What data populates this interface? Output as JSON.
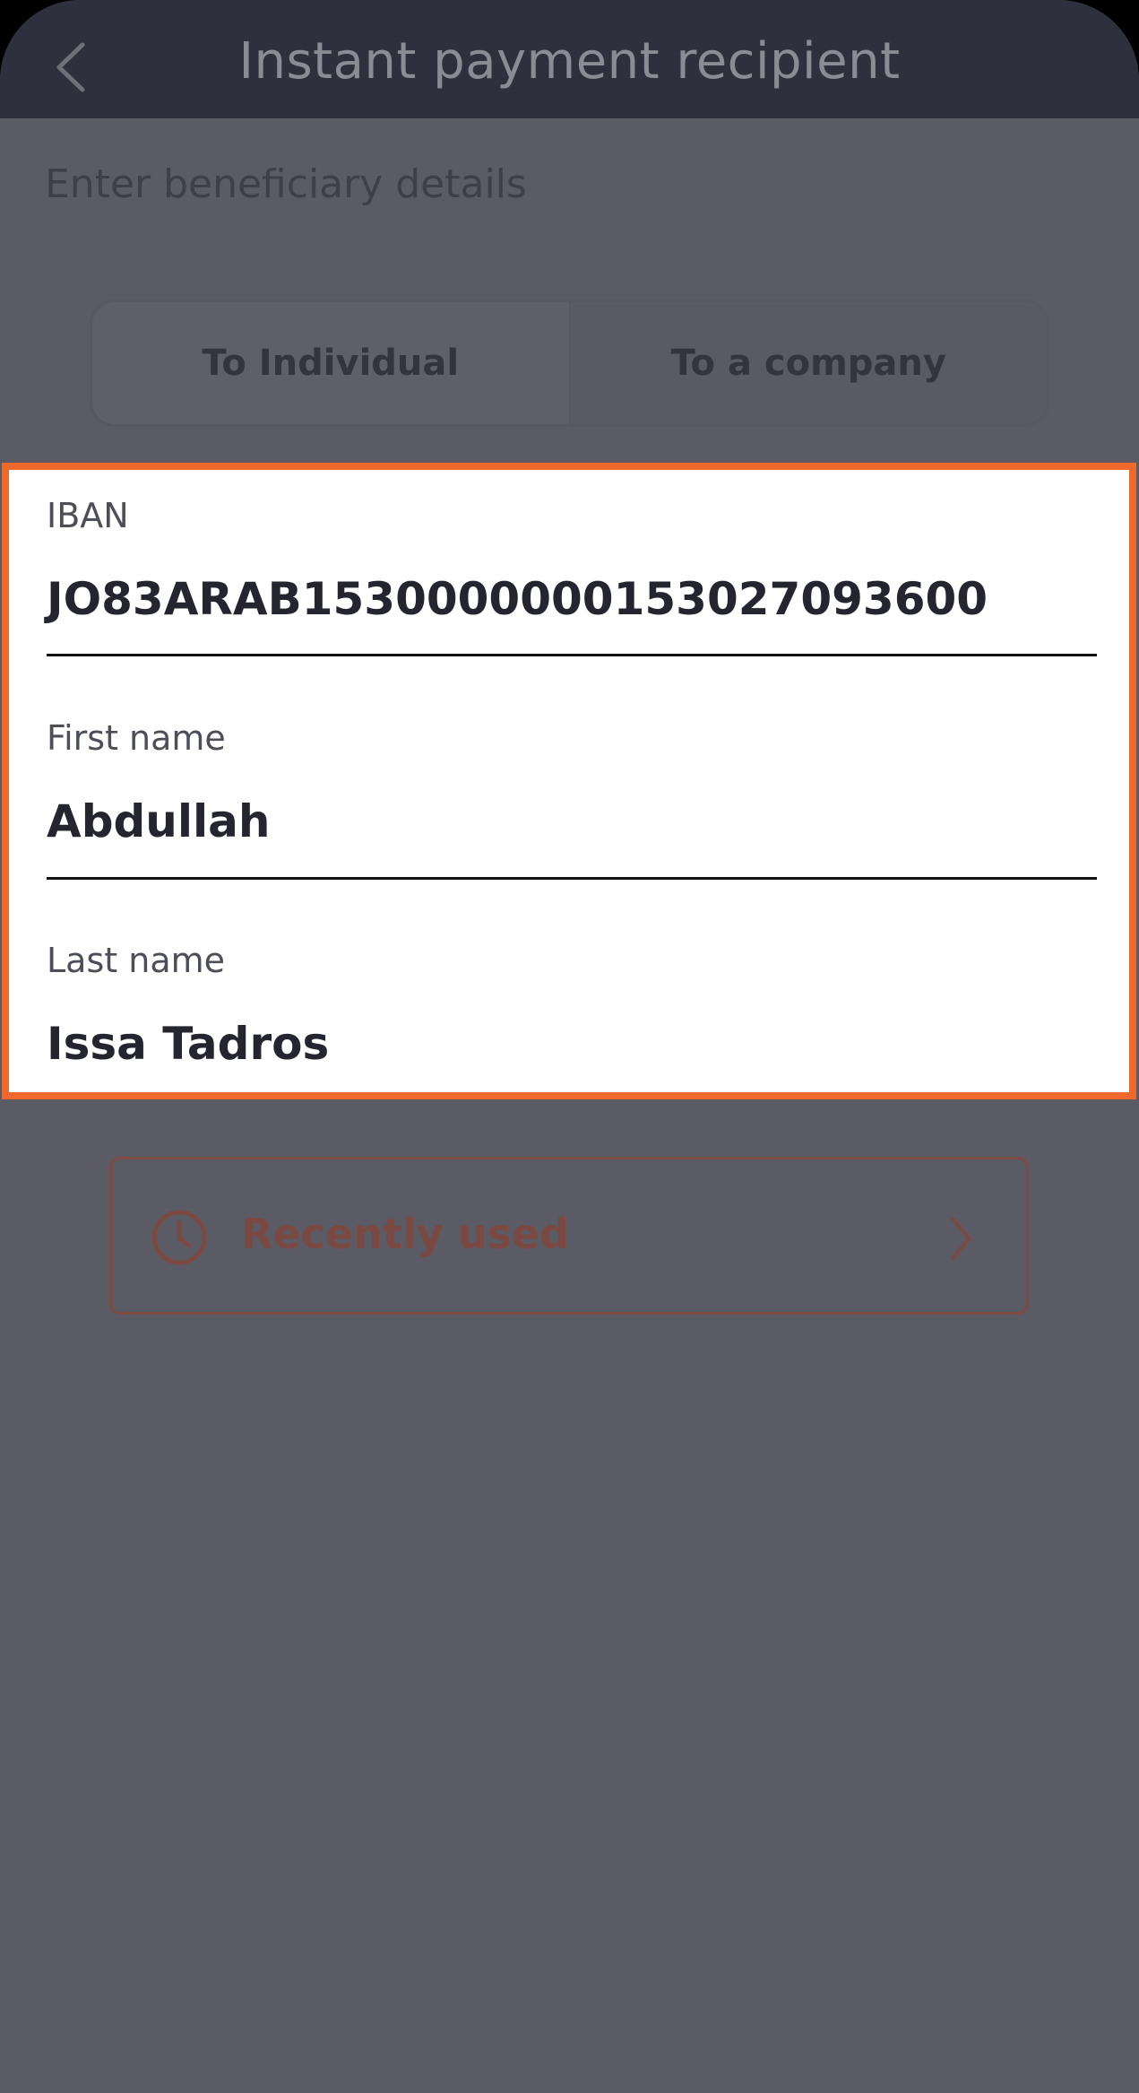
{
  "header": {
    "title": "Instant payment recipient",
    "back_icon": "chevron-left-icon"
  },
  "subtitle": "Enter beneficiary details",
  "segment": {
    "options": [
      "To Individual",
      "To a company"
    ]
  },
  "form": {
    "iban": {
      "label": "IBAN",
      "value": "JO83ARAB1530000000153027093600"
    },
    "first_name": {
      "label": "First name",
      "value": "Abdullah"
    },
    "last_name": {
      "label": "Last name",
      "value": "Issa Tadros"
    }
  },
  "recent": {
    "label": "Recently used",
    "icon": "clock-icon",
    "chevron": "chevron-right-icon"
  },
  "colors": {
    "header_bg": "#2e303d",
    "overlay_bg": "#5b5b66",
    "highlight": "#f0692c",
    "recent_accent": "#7a4a42"
  }
}
